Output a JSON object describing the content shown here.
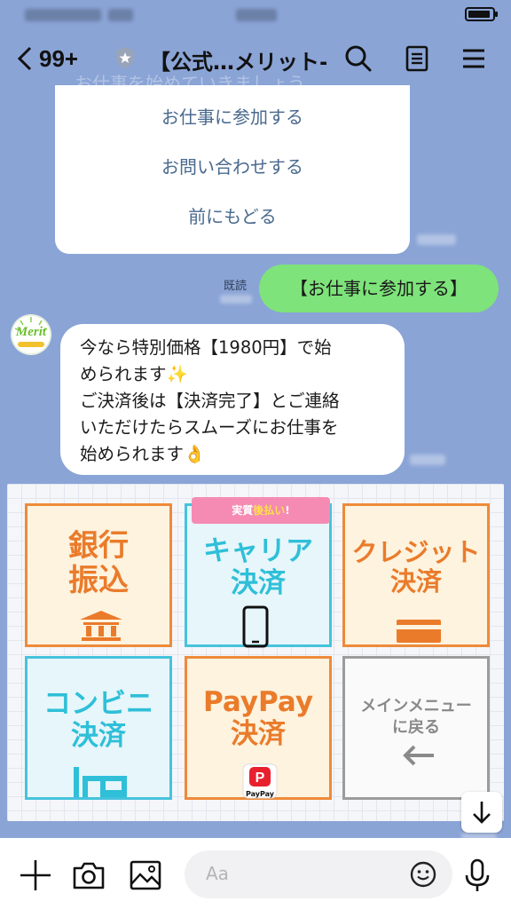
{
  "status_bar": {},
  "header": {
    "back_count": "99+",
    "title": "【公式…メリット-",
    "ghost_text": "お仕事を始めていきましょう"
  },
  "quick_menu": {
    "items": [
      {
        "label": "お仕事に参加する"
      },
      {
        "label": "お問い合わせする"
      },
      {
        "label": "前にもどる"
      }
    ]
  },
  "messages": {
    "sent": {
      "read_label": "既読",
      "text": "【お仕事に参加する】"
    },
    "received": {
      "avatar_text": "Merit",
      "lines": [
        "今なら特別価格【1980円】で始",
        "められます✨",
        "ご決済後は【決済完了】とご連絡",
        "いただけたらスムーズにお仕事を",
        "始められます👌"
      ]
    }
  },
  "rich_menu": {
    "ribbon": {
      "prefix": "実質",
      "emphasis": "後払い",
      "suffix": "!"
    },
    "tiles": [
      {
        "line1": "銀行",
        "line2": "振込",
        "icon": "bank-icon"
      },
      {
        "line1": "キャリア",
        "line2": "決済",
        "icon": "smartphone-icon"
      },
      {
        "line1": "クレジット",
        "line2": "決済",
        "icon": "credit-card-icon"
      },
      {
        "line1": "コンビニ",
        "line2": "決済",
        "icon": "convenience-store-icon"
      },
      {
        "line1": "PayPay",
        "line2": "決済",
        "icon": "paypay-icon",
        "badge": "PayPay"
      },
      {
        "line1": "メインメニュー",
        "line2": "に戻る",
        "icon": "arrow-left-icon"
      }
    ]
  },
  "composer": {
    "placeholder": "Aa"
  },
  "colors": {
    "chat_bg": "#8aa4d6",
    "sent_bubble": "#7ee37a",
    "tile_orange": "#ea7b2b",
    "tile_cyan": "#2fbfd8",
    "ribbon_pink": "#f58bb3"
  }
}
